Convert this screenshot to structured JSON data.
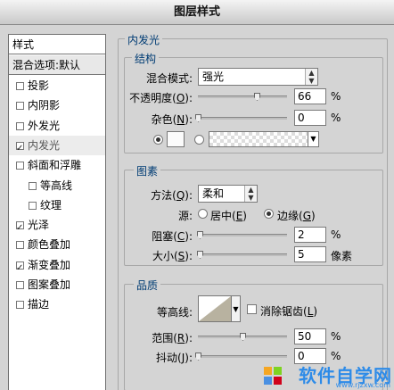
{
  "window": {
    "title": "图层样式"
  },
  "styles_panel": {
    "header": "样式",
    "blend_options": "混合选项:默认",
    "items": [
      {
        "label": "投影",
        "checked": false
      },
      {
        "label": "内阴影",
        "checked": false
      },
      {
        "label": "外发光",
        "checked": false
      },
      {
        "label": "内发光",
        "checked": true,
        "selected": true
      },
      {
        "label": "斜面和浮雕",
        "checked": false
      },
      {
        "label": "等高线",
        "checked": false,
        "sub": true
      },
      {
        "label": "纹理",
        "checked": false,
        "sub": true
      },
      {
        "label": "光泽",
        "checked": true
      },
      {
        "label": "颜色叠加",
        "checked": false
      },
      {
        "label": "渐变叠加",
        "checked": true
      },
      {
        "label": "图案叠加",
        "checked": false
      },
      {
        "label": "描边",
        "checked": false
      }
    ]
  },
  "inner_glow": {
    "title": "内发光",
    "structure": {
      "title": "结构",
      "blend_mode_label": "混合模式:",
      "blend_mode_value": "强光",
      "opacity_label": "不透明度(",
      "opacity_key": "O",
      "opacity_label_end": "):",
      "opacity_value": "66",
      "opacity_unit": "%",
      "noise_label": "杂色(",
      "noise_key": "N",
      "noise_label_end": "):",
      "noise_value": "0",
      "noise_unit": "%"
    },
    "elements": {
      "title": "图素",
      "method_label": "方法(",
      "method_key": "Q",
      "method_label_end": "):",
      "method_value": "柔和",
      "source_label": "源:",
      "source_center": "居中(",
      "source_center_key": "E",
      "source_center_end": ")",
      "source_edge": "边缘(",
      "source_edge_key": "G",
      "source_edge_end": ")",
      "choke_label": "阻塞(",
      "choke_key": "C",
      "choke_label_end": "):",
      "choke_value": "2",
      "choke_unit": "%",
      "size_label": "大小(",
      "size_key": "S",
      "size_label_end": "):",
      "size_value": "5",
      "size_unit": "像素"
    },
    "quality": {
      "title": "品质",
      "contour_label": "等高线:",
      "antialias_label": "消除锯齿(",
      "antialias_key": "L",
      "antialias_end": ")",
      "range_label": "范围(",
      "range_key": "R",
      "range_label_end": "):",
      "range_value": "50",
      "range_unit": "%",
      "jitter_label": "抖动(",
      "jitter_key": "J",
      "jitter_label_end": "):",
      "jitter_value": "0",
      "jitter_unit": "%"
    }
  },
  "watermark": {
    "text": "软件自学网",
    "url": "www.rjzxw.com"
  },
  "slider_levels": {
    "opacity": 0.66,
    "noise": 0.0,
    "choke": 0.02,
    "size": 0.02,
    "range": 0.5,
    "jitter": 0.0
  },
  "colors": {
    "accent_title": "#003c74",
    "watermark": "#2d8be8"
  }
}
